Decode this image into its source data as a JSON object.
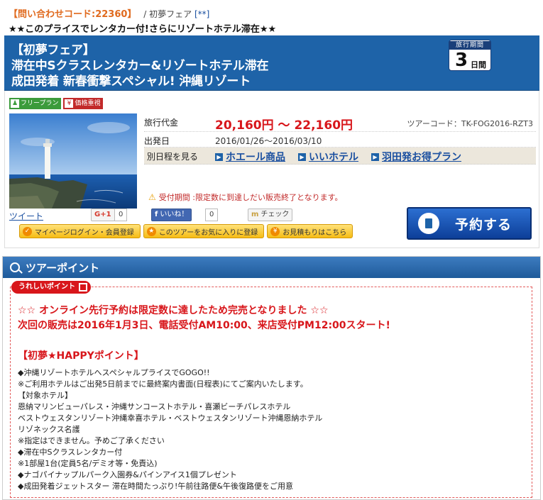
{
  "header": {
    "inquiry_code": "【問い合わせコード:22360】",
    "breadcrumb_sep": "/",
    "breadcrumb_name": "初夢フェア",
    "breadcrumb_tag": "[**]",
    "catchcopy": "★★このプライスでレンタカー付!さらにリゾートホテル滞在★★"
  },
  "banner": {
    "line1": "【初夢フェア】",
    "line2": "滞在中Sクラスレンタカー&リゾートホテル滞在",
    "line3": "成田発着 新春衝撃スペシャル! 沖縄リゾート",
    "period_label": "旅行期間",
    "period_num": "3",
    "period_unit": "日間",
    "color": "#1e63a8"
  },
  "badges": [
    {
      "label": "フリープラン",
      "icon": "walking-person-icon"
    },
    {
      "label": "価格重視",
      "icon": "yen-icon"
    }
  ],
  "photo": {
    "subject": "lighthouse on cliff by the sea",
    "icon": "lighthouse-photo"
  },
  "details": {
    "price_key": "旅行代金",
    "price_value": "20,160円 ～ 22,160円",
    "tour_code": "ツアーコード：TK-FOG2016-RZT3",
    "depart_key": "出発日",
    "depart_value": "2016/01/26～2016/03/10",
    "alt_key": "別日程を見る",
    "alt_links": [
      "ホエール商品",
      "いいホテル",
      "羽田発お得プラン"
    ],
    "notice": "受付期間 :限定数に到達しだい販売終了となります。",
    "price_color": "#d8161b"
  },
  "social": {
    "tweet": "ツイート",
    "gplus": "G+1",
    "gplus_count": "0",
    "fb_like": "いいね！",
    "fb_count": "0",
    "mixi_check": "チェック"
  },
  "actions": {
    "mypage": "マイページログイン・会員登録",
    "favorite": "このツアーをお気に入りに登録",
    "estimate": "お見積もりはこちら",
    "reserve": "予約する"
  },
  "points": {
    "title": "ツアーポイント",
    "tag": "うれしいポイント",
    "alert1": "☆☆ オンライン先行予約は限定数に達したため完売となりました ☆☆",
    "alert2": "次回の販売は2016年1月3日、電話受付AM10:00、来店受付PM12:00スタート!",
    "heading": "【初夢★HAPPYポイント】",
    "lines": [
      "◆沖縄リゾートホテルへスペシャルプライスでGOGO!!",
      "※ご利用ホテルはご出発5日前までに最終案内書面(日程表)にてご案内いたします。",
      "【対象ホテル】",
      "恩納マリンビューパレス・沖縄サンコーストホテル・喜瀬ビーチパレスホテル",
      "ベストウェスタンリゾート沖縄幸喜ホテル・ベストウェスタンリゾート沖縄恩納ホテル",
      "リゾネックス名護",
      "※指定はできません。予めご了承ください",
      "◆滞在中Sクラスレンタカー付",
      "※1部屋1台(定員5名/デミオ等・免責込)",
      "◆ナゴパイナップルパーク入園券&パインアイス1個プレゼント",
      "◆成田発着ジェットスター 滞在時間たっぷり!午前往路便&午後復路便をご用意"
    ]
  }
}
